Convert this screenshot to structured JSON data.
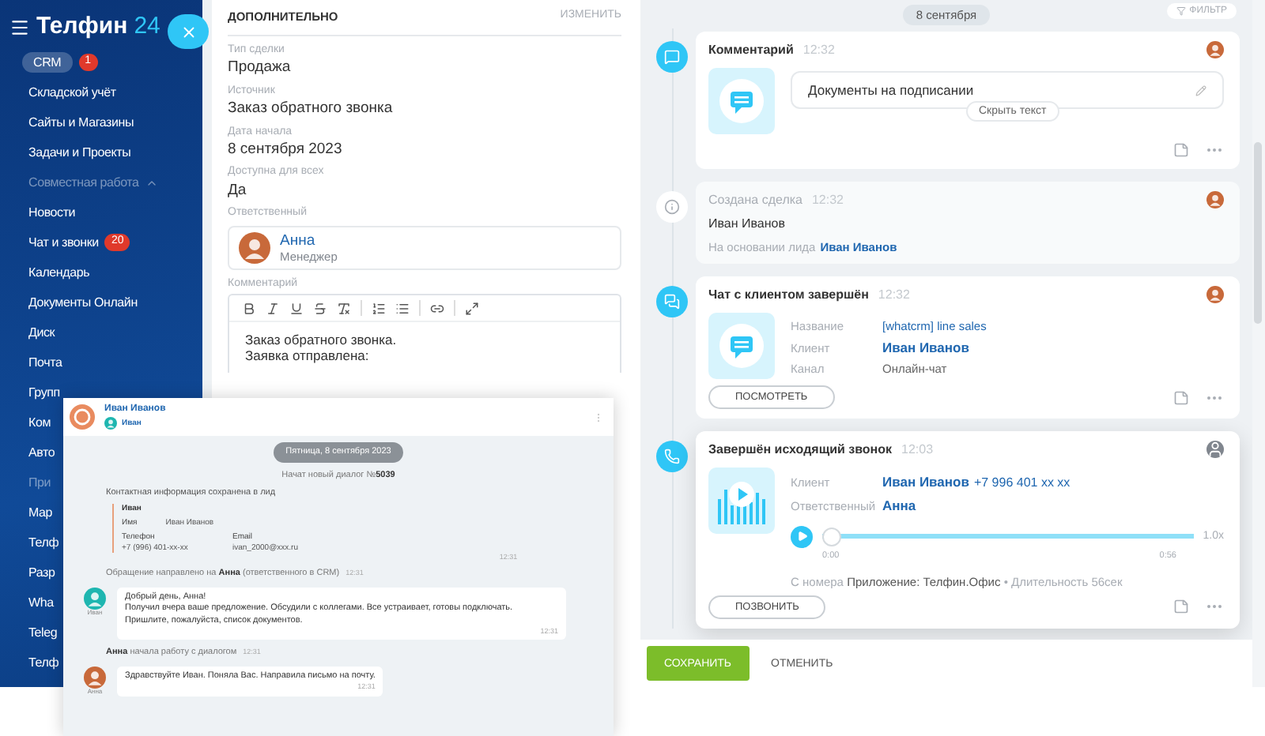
{
  "sidebar": {
    "logo": {
      "name": "Телфин",
      "suffix": "24"
    },
    "items": [
      {
        "label": "CRM",
        "badge": "1",
        "kind": "item",
        "selected": true
      },
      {
        "label": "Складской учёт",
        "kind": "item",
        "selected": false
      },
      {
        "label": "Сайты и Магазины",
        "kind": "item",
        "selected": false
      },
      {
        "label": "Задачи и Проекты",
        "kind": "item",
        "selected": false
      },
      {
        "label": "Совместная работа",
        "kind": "section",
        "expanded": true,
        "selected": false
      },
      {
        "label": "Новости",
        "kind": "item",
        "selected": false
      },
      {
        "label": "Чат и звонки",
        "badge": "20",
        "kind": "item",
        "selected": false
      },
      {
        "label": "Календарь",
        "kind": "item",
        "selected": false
      },
      {
        "label": "Документы Онлайн",
        "kind": "item",
        "selected": false
      },
      {
        "label": "Диск",
        "kind": "item",
        "selected": false
      },
      {
        "label": "Почта",
        "kind": "item",
        "selected": false
      },
      {
        "label": "Групп",
        "kind": "item",
        "selected": false
      },
      {
        "label": "Ком",
        "kind": "item",
        "selected": false
      },
      {
        "label": "Авто",
        "kind": "item",
        "selected": false
      },
      {
        "label": "При",
        "kind": "section",
        "selected": false
      },
      {
        "label": "Мар",
        "kind": "item",
        "selected": false
      },
      {
        "label": "Телф",
        "kind": "item",
        "selected": false
      },
      {
        "label": "Разр",
        "kind": "item",
        "selected": false
      },
      {
        "label": "Wha",
        "kind": "item",
        "selected": false
      },
      {
        "label": "Teleg",
        "kind": "item",
        "selected": false
      },
      {
        "label": "Телф",
        "kind": "item",
        "selected": false
      }
    ]
  },
  "deal": {
    "heading": "ДОПОЛНИТЕЛЬНО",
    "edit": "ИЗМЕНИТЬ",
    "fields": [
      {
        "label": "Тип сделки",
        "value": "Продажа"
      },
      {
        "label": "Источник",
        "value": "Заказ обратного звонка"
      },
      {
        "label": "Дата начала",
        "value": "8 сентября 2023"
      },
      {
        "label": "Доступна для всех",
        "value": "Да"
      }
    ],
    "responsible": {
      "label": "Ответственный",
      "name": "Анна",
      "role": "Менеджер"
    },
    "comment": {
      "label": "Комментарий",
      "lines": [
        "Заказ обратного звонка.",
        "Заявка отправлена:"
      ]
    }
  },
  "timeline": {
    "date": "8 сентября",
    "filter": "ФИЛЬТР",
    "entries": [
      {
        "kind": "comment",
        "title": "Комментарий",
        "time": "12:32",
        "text": "Документы на подписании",
        "toggle": "Скрыть текст"
      },
      {
        "kind": "created",
        "title": "Создана сделка",
        "time": "12:32",
        "name": "Иван Иванов",
        "basis": "На основании лида",
        "link": "Иван Иванов"
      },
      {
        "kind": "chat",
        "title": "Чат с клиентом завершён",
        "time": "12:32",
        "fields": [
          {
            "label": "Название",
            "value": "[whatcrm] line sales",
            "kind": "link"
          },
          {
            "label": "Клиент",
            "value": "Иван Иванов",
            "kind": "strong"
          },
          {
            "label": "Канал",
            "value": "Онлайн-чат",
            "kind": "plain"
          }
        ],
        "button": "ПОСМОТРЕТЬ"
      },
      {
        "kind": "call",
        "title": "Завершён исходящий звонок",
        "time": "12:03",
        "fields": [
          {
            "label": "Клиент",
            "value": "Иван Иванов",
            "extra": "+7 996 401 xx xx",
            "kind": "strong"
          },
          {
            "label": "Ответственный",
            "value": "Анна",
            "kind": "strong"
          }
        ],
        "player": {
          "level": 0,
          "speed": "1.0x",
          "start": "0:00",
          "end": "0:56"
        },
        "source": "С номера **Приложение: Телфин.Офис** • Длительность 56сек",
        "button": "ПОЗВОНИТЬ"
      }
    ]
  },
  "actions": {
    "save": "СОХРАНИТЬ",
    "cancel": "ОТМЕНИТЬ"
  },
  "chat_window": {
    "contact": "Иван Иванов",
    "subtitle": "Иван",
    "items": [
      {
        "kind": "date",
        "text": "Пятница, 8 сентября 2023"
      },
      {
        "kind": "system",
        "text": "Начат новый диалог №**5039**"
      },
      {
        "kind": "card",
        "title": "Контактная информация сохранена в лид",
        "name": "Иван",
        "fields": [
          {
            "label": "Имя",
            "value": "Иван Иванов",
            "kind": "inline"
          },
          {
            "label": "Телефон",
            "value": "+7 (996) 401-xx-xx",
            "kind": "stacked"
          },
          {
            "label": "Email",
            "value": "ivan_2000@xxx.ru",
            "kind": "stacked"
          }
        ],
        "time": "12:31"
      },
      {
        "kind": "system",
        "text": "Обращение направлено на **Анна** (ответственного в CRM)",
        "time": "12:31"
      },
      {
        "kind": "message",
        "author": "Иван",
        "color": "#1eb6b0",
        "lines": [
          "Добрый день, Анна!",
          "Получил вчера ваше предложение. Обсудили с коллегами. Все устраивает, готовы подключать. Пришлите, пожалуйста, список документов."
        ],
        "time": "12:31"
      },
      {
        "kind": "system",
        "text": "**Анна** начала работу с диалогом",
        "time": "12:31"
      },
      {
        "kind": "message",
        "author": "Анна",
        "color": "#c8693a",
        "lines": [
          "Здравствуйте Иван. Поняла Вас. Направила письмо на почту."
        ],
        "time": "12:31"
      }
    ]
  }
}
